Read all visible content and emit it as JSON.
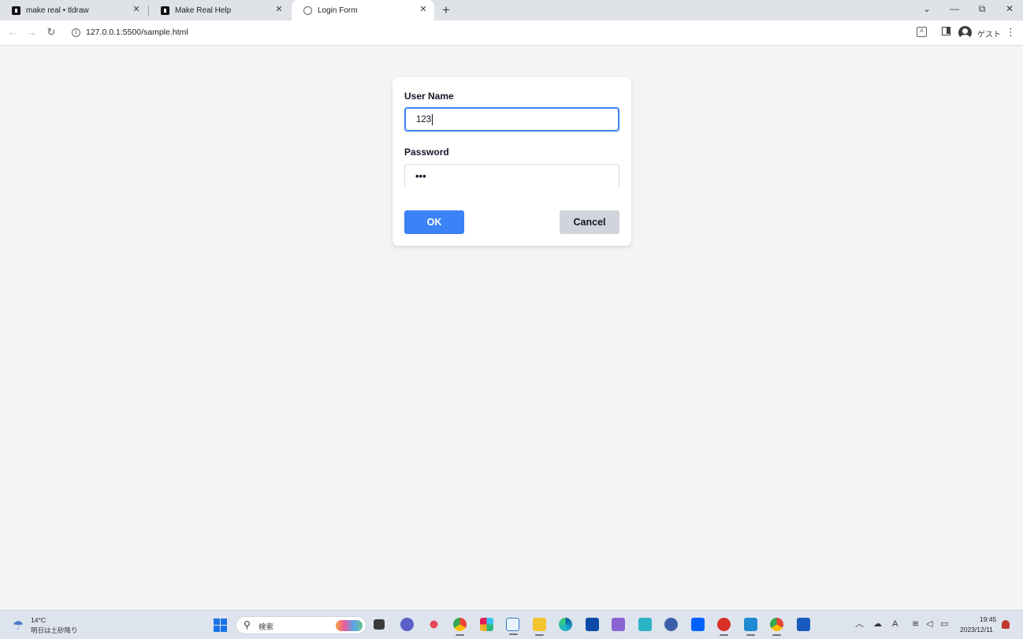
{
  "browser": {
    "tabs": [
      {
        "title": "make real • tldraw",
        "icon": "tldraw-favicon",
        "active": false
      },
      {
        "title": "Make Real Help",
        "icon": "tldraw-favicon",
        "active": false
      },
      {
        "title": "Login Form",
        "icon": "globe-icon",
        "active": true
      }
    ],
    "new_tab_label": "+",
    "window_controls": {
      "tab_search": "⌄",
      "minimize": "—",
      "restore": "⧉",
      "close": "✕"
    },
    "url": "127.0.0.1:5500/sample.html",
    "profile_label": "ゲスト"
  },
  "form": {
    "username_label": "User Name",
    "username_value": "123",
    "password_label": "Password",
    "password_masked": "•••",
    "ok_label": "OK",
    "cancel_label": "Cancel"
  },
  "taskbar": {
    "temperature": "14°C",
    "forecast": "明日は土砂降り",
    "search_placeholder": "検索",
    "time": "19:45",
    "date": "2023/12/11",
    "apps": [
      "task-view",
      "teams",
      "slack-like",
      "chrome",
      "slack",
      "notepad",
      "file-explorer",
      "edge",
      "store",
      "app-purple",
      "app-teal",
      "app-circle",
      "dropbox",
      "app-red",
      "vscode",
      "chrome-active",
      "word"
    ]
  },
  "colors": {
    "accent": "#3b82f6",
    "cancel_bg": "#d1d5db",
    "page_bg": "#f3f4f6",
    "tab_strip": "#dfe3e7"
  }
}
